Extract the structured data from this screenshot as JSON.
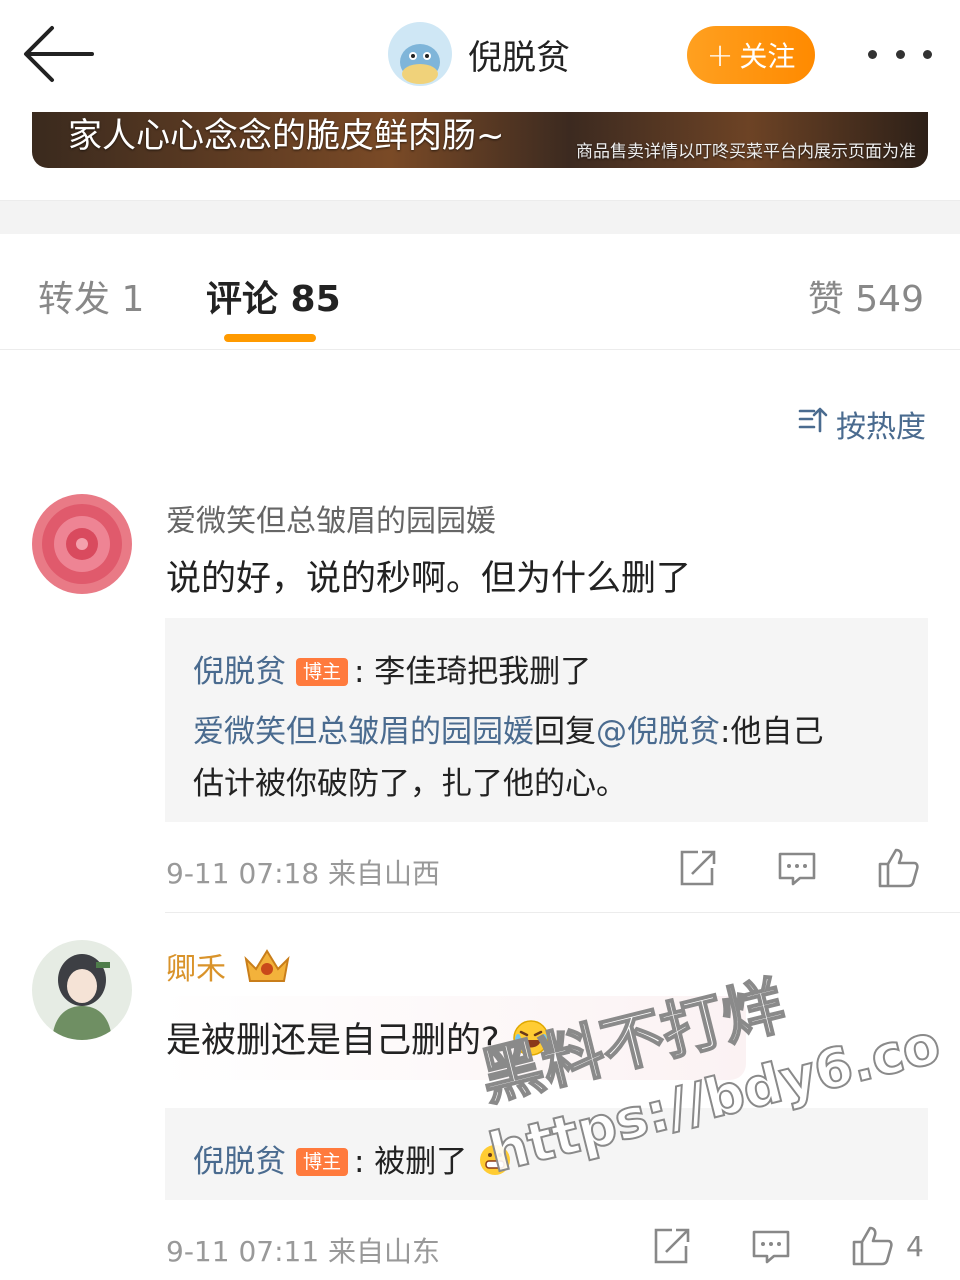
{
  "header": {
    "profile_name": "倪脱贫",
    "follow_label": "关注",
    "follow_plus": "+"
  },
  "banner": {
    "text": "家人心心念念的脆皮鲜肉肠~",
    "note": "商品售卖详情以叮咚买菜平台内展示页面为准"
  },
  "tabs": {
    "repost": "转发 1",
    "comment": "评论 85",
    "like": "赞 549"
  },
  "sort": {
    "label": "按热度"
  },
  "comments": [
    {
      "user": "爱微笑但总皱眉的园园媛",
      "text": "说的好，说的秒啊。但为什么删了",
      "replies": {
        "r1_user": "倪脱贫",
        "r1_badge": "博主",
        "r1_text": ": 李佳琦把我删了",
        "r2_user": "爱微笑但总皱眉的园园媛",
        "r2_reply": "回复",
        "r2_at": "@倪脱贫",
        "r2_text1": ":他自己",
        "r2_text2": "估计被你破防了，扎了他的心。"
      },
      "meta": "9-11 07:18  来自山西"
    },
    {
      "user": "卿禾",
      "text": "是被删还是自己删的?",
      "replies": {
        "r1_user": "倪脱贫",
        "r1_badge": "博主",
        "r1_text": ": 被删了"
      },
      "meta": "9-11 07:11  来自山东",
      "likes": "4"
    }
  ],
  "watermark": {
    "line1": "黑料不打烊",
    "line2": "https://bdy6.co"
  },
  "colors": {
    "accent": "#ff9a00",
    "link": "#4a6b8f",
    "badge": "#ff7a3d",
    "vip_name": "#d9932a"
  }
}
